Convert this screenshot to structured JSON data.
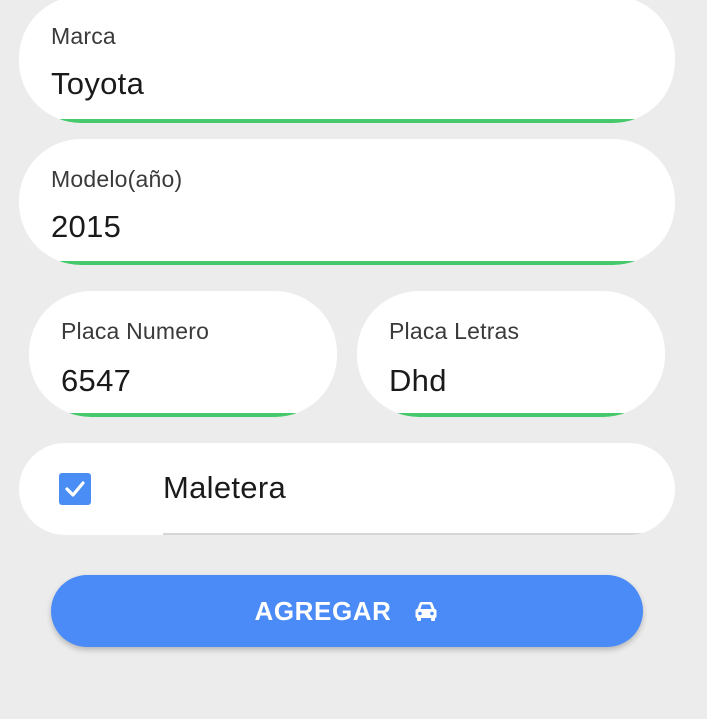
{
  "form": {
    "marca": {
      "label": "Marca",
      "value": "Toyota"
    },
    "modelo": {
      "label": "Modelo(año)",
      "value": "2015"
    },
    "placa_numero": {
      "label": "Placa Numero",
      "value": "6547"
    },
    "placa_letras": {
      "label": "Placa Letras",
      "value": "Dhd"
    },
    "maletera": {
      "label": "Maletera",
      "checked": true
    }
  },
  "actions": {
    "agregar": {
      "label": "AGREGAR",
      "icon": "car-icon"
    }
  },
  "colors": {
    "background": "#ececec",
    "field_underline": "#46c96a",
    "primary": "#4a8bf7",
    "checkbox": "#4a8ef5"
  }
}
